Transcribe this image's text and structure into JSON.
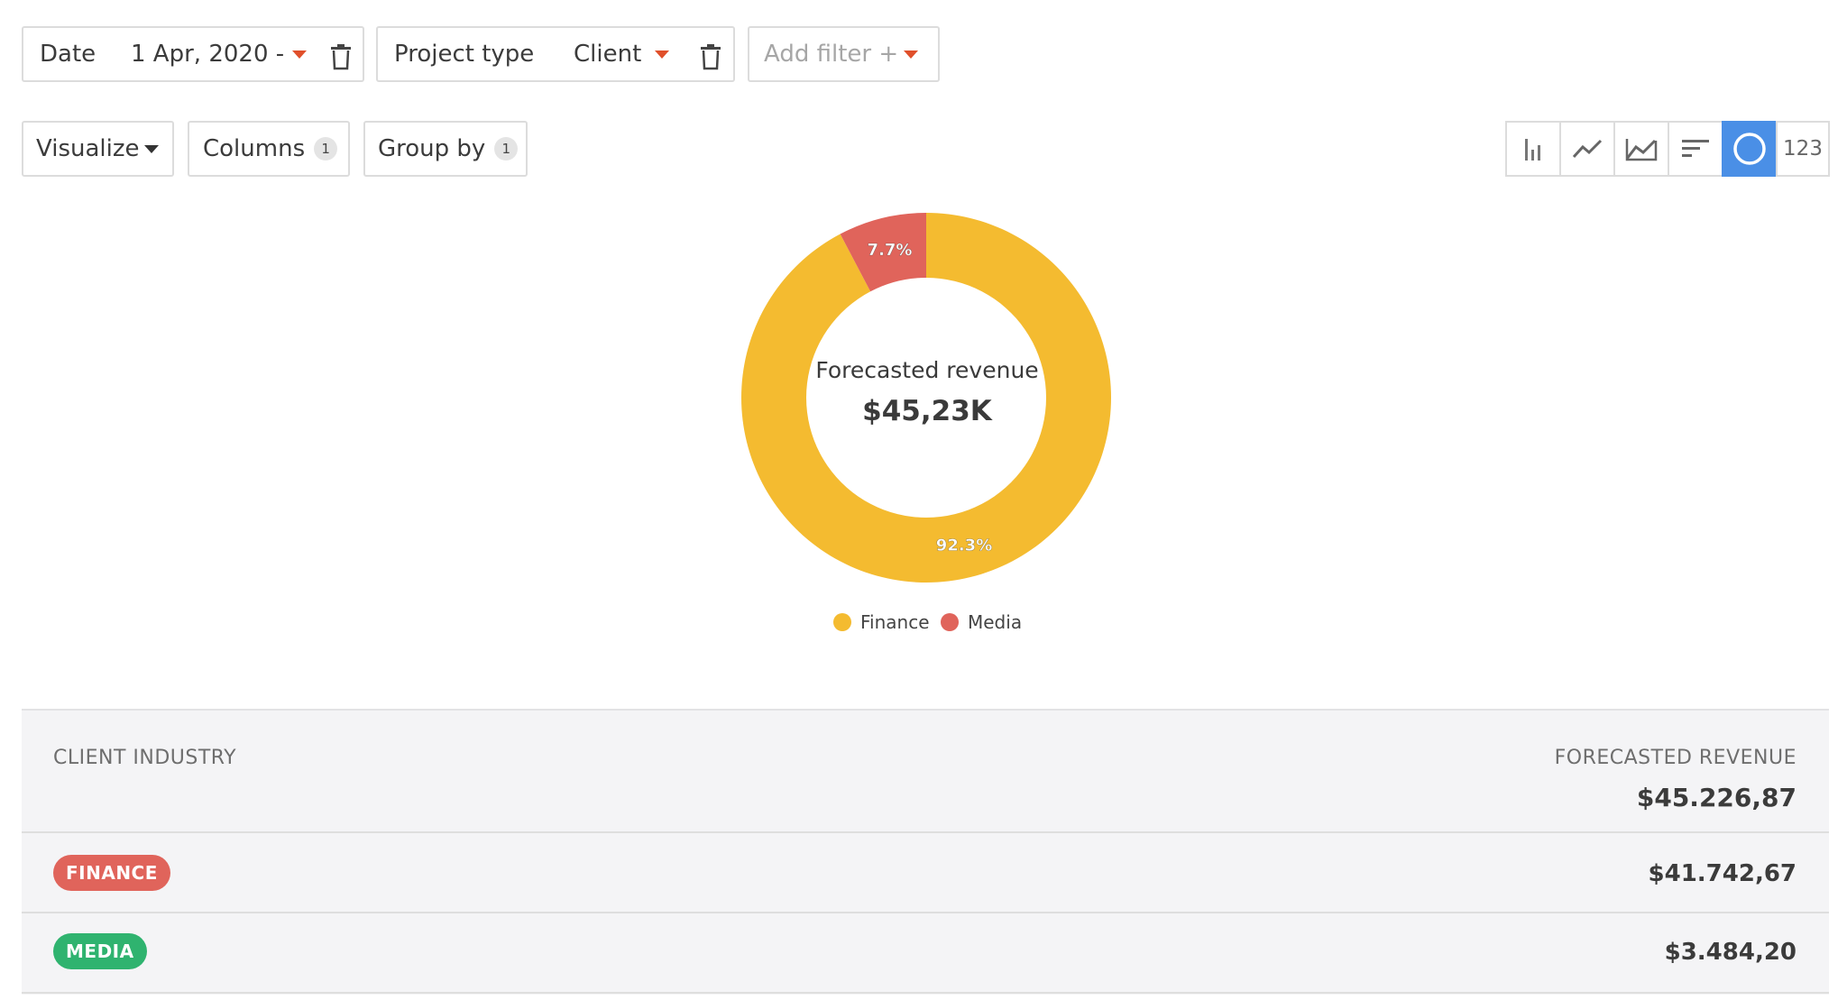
{
  "filters": {
    "date": {
      "label": "Date",
      "value": "1 Apr, 2020 -"
    },
    "project_type": {
      "label": "Project type",
      "value": "Client"
    },
    "add_filter": {
      "label": "Add filter +"
    }
  },
  "toolbar": {
    "visualize_label": "Visualize",
    "columns_label": "Columns",
    "columns_count": "1",
    "group_by_label": "Group by",
    "group_by_count": "1",
    "view_buttons": [
      {
        "icon": "bar-chart-icon",
        "active": false
      },
      {
        "icon": "line-chart-icon",
        "active": false
      },
      {
        "icon": "area-chart-icon",
        "active": false
      },
      {
        "icon": "horizontal-bar-chart-icon",
        "active": false
      },
      {
        "icon": "donut-chart-icon",
        "active": true
      },
      {
        "label": "123",
        "active": false
      }
    ],
    "numbers_view_label": "123"
  },
  "chart_data": {
    "type": "pie",
    "donut": true,
    "center_label": "Forecasted revenue",
    "center_value": "$45,23K",
    "categories": [
      "Finance",
      "Media"
    ],
    "values": [
      92.3,
      7.7
    ],
    "value_labels": [
      "92.3%",
      "7.7%"
    ],
    "colors": [
      "#f4bb30",
      "#e0645b"
    ],
    "legend_position": "bottom"
  },
  "table": {
    "col_left": "CLIENT INDUSTRY",
    "col_right": "FORECASTED REVENUE",
    "total": "$45.226,87",
    "rows": [
      {
        "tag": "FINANCE",
        "tag_color": "#e0645b",
        "value": "$41.742,67"
      },
      {
        "tag": "MEDIA",
        "tag_color": "#2fb36f",
        "value": "$3.484,20"
      }
    ]
  }
}
